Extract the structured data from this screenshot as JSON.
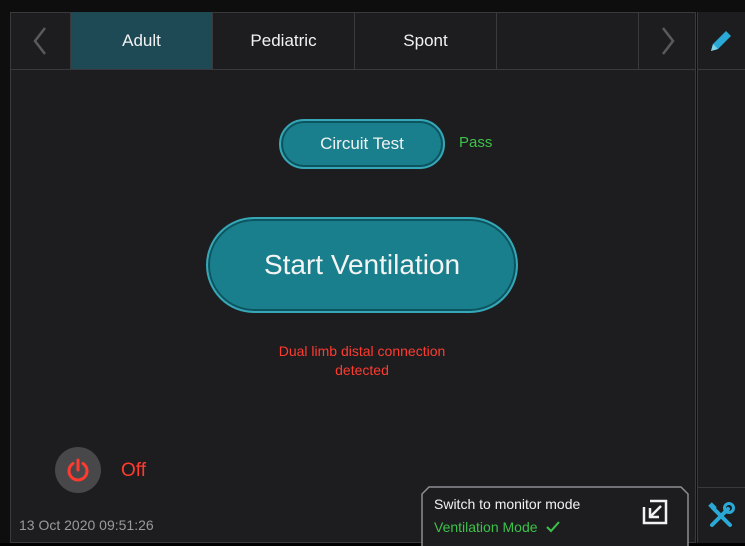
{
  "tabs": {
    "items": [
      {
        "label": "Adult",
        "active": true
      },
      {
        "label": "Pediatric",
        "active": false
      },
      {
        "label": "Spont",
        "active": false
      },
      {
        "label": "",
        "active": false
      }
    ],
    "prev_icon": "chevron-left-icon",
    "next_icon": "chevron-right-icon"
  },
  "sidebar": {
    "edit_icon": "pencil-icon",
    "tools_icon": "tools-icon"
  },
  "circuit_test": {
    "label": "Circuit Test",
    "status": "Pass"
  },
  "start_ventilation": {
    "label": "Start Ventilation"
  },
  "alert": {
    "line1": "Dual limb distal connection",
    "line2": "detected"
  },
  "power": {
    "label": "Off",
    "icon": "power-icon"
  },
  "datetime": "13 Oct 2020 09:51:26",
  "monitor_mode": {
    "title": "Switch to monitor mode",
    "status": "Ventilation Mode",
    "icon": "arrow-down-left-icon"
  },
  "colors": {
    "background": "#1d1d1f",
    "accent_button": "#1a7f8d",
    "active_tab": "#1d4a55",
    "pass_green": "#3cc24a",
    "alert_red": "#ff3b30",
    "edit_icon": "#2aa9d6",
    "tools_icon": "#2aa9d6"
  }
}
